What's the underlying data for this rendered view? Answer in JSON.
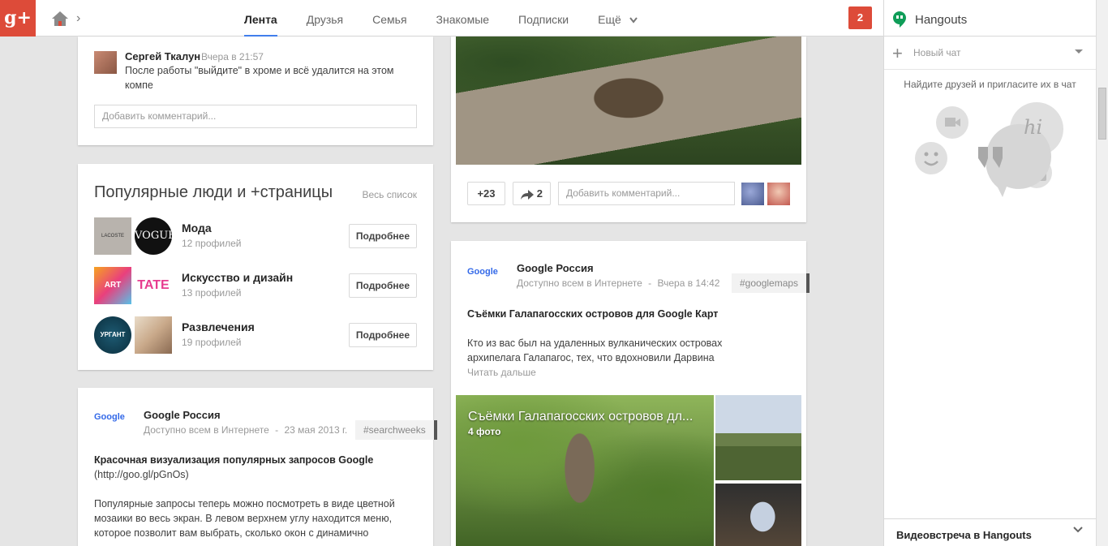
{
  "app": {
    "logo_text": "g+"
  },
  "nav": {
    "tabs": [
      {
        "label": "Лента",
        "active": true
      },
      {
        "label": "Друзья"
      },
      {
        "label": "Семья"
      },
      {
        "label": "Знакомые"
      },
      {
        "label": "Подписки"
      },
      {
        "label": "Ещё"
      }
    ]
  },
  "notifications": {
    "count": "2"
  },
  "hangouts": {
    "title": "Hangouts",
    "new_chat": "Новый чат",
    "find_friends": "Найдите друзей и пригласите их в чат",
    "video_call": "Видеовстреча в Hangouts",
    "bubble_text": "hi"
  },
  "comment_card": {
    "author": "Сергей Ткалун",
    "time": "Вчера в 21:57",
    "text": "После работы \"выйдите\" в хроме и всё удалится на этом компе",
    "input_placeholder": "Добавить комментарий..."
  },
  "popular": {
    "title": "Популярные люди и +страницы",
    "all_link": "Весь список",
    "rows": [
      {
        "name": "Мода",
        "count": "12 профилей",
        "button": "Подробнее",
        "thumb1": "LACOSTE",
        "thumb2": "VOGUE"
      },
      {
        "name": "Искусство и дизайн",
        "count": "13 профилей",
        "button": "Подробнее",
        "thumb1": "ART COM",
        "thumb2": "TATE"
      },
      {
        "name": "Развлечения",
        "count": "19 профилей",
        "button": "Подробнее",
        "thumb1": "УРГАНТ",
        "thumb2": ""
      }
    ]
  },
  "post_left": {
    "author": "Google Россия",
    "visibility": "Доступно всем в Интернете",
    "sep": "-",
    "date": "23 мая 2013 г.",
    "hashtag": "#searchweeks",
    "title": "Красочная визуализация популярных запросов Google",
    "link": "(http://goo.gl/pGnOs)",
    "body": "Популярные запросы теперь можно посмотреть в виде цветной мозаики во весь экран. В левом верхнем углу находится меню, которое позволит вам выбрать, сколько окон с динамично"
  },
  "post_top_right": {
    "plus_count": "+23",
    "share_count": "2",
    "input_placeholder": "Добавить комментарий..."
  },
  "post_right": {
    "author": "Google Россия",
    "visibility": "Доступно всем в Интернете",
    "sep": "-",
    "date": "Вчера в 14:42",
    "hashtag": "#googlemaps",
    "title": "Съёмки Галапагосских островов для Google Карт",
    "body": "Кто из вас был на удаленных вулканических островах архипелага Галапагос, тех, что вдохновили Дарвина",
    "read_more": "Читать дальше",
    "album_title": "Съёмки Галапагосских островов дл...",
    "album_count": "4 фото"
  },
  "logo_word": "Google",
  "colors": {
    "brand": "#dd4b39",
    "accent": "#427fed",
    "hangouts": "#0f9d58"
  }
}
